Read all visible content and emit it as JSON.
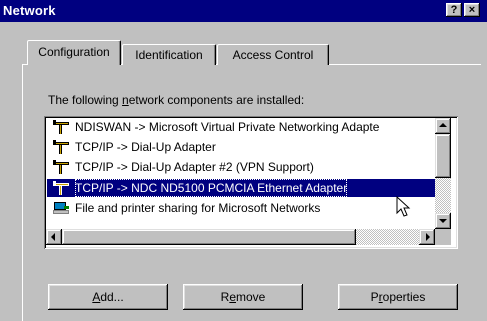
{
  "window": {
    "title": "Network",
    "help_button": "?",
    "close_button": "×"
  },
  "tabs": [
    {
      "label": "Configuration",
      "active": true
    },
    {
      "label": "Identification",
      "active": false
    },
    {
      "label": "Access Control",
      "active": false
    }
  ],
  "components": {
    "label_prefix": "The following ",
    "label_mnemonic": "n",
    "label_suffix": "etwork components are installed:",
    "items": [
      {
        "label": "NDISWAN -> Microsoft Virtual Private Networking Adapte",
        "icon": "network-protocol-icon",
        "selected": false
      },
      {
        "label": "TCP/IP -> Dial-Up Adapter",
        "icon": "network-protocol-icon",
        "selected": false
      },
      {
        "label": "TCP/IP -> Dial-Up Adapter #2 (VPN Support)",
        "icon": "network-protocol-icon",
        "selected": false
      },
      {
        "label": "TCP/IP -> NDC ND5100 PCMCIA Ethernet Adapter",
        "icon": "network-protocol-icon",
        "selected": true
      },
      {
        "label": "File and printer sharing for Microsoft Networks",
        "icon": "file-sharing-service-icon",
        "selected": false
      }
    ]
  },
  "buttons": {
    "add": {
      "mnemonic": "A",
      "rest": "dd..."
    },
    "remove": {
      "prefix": "R",
      "mnemonic": "e",
      "rest": "move"
    },
    "properties": {
      "prefix": "P",
      "mnemonic": "r",
      "rest": "operties"
    }
  },
  "colors": {
    "titlebar": "#000080",
    "face": "#c0c0c0",
    "selection": "#000080"
  }
}
